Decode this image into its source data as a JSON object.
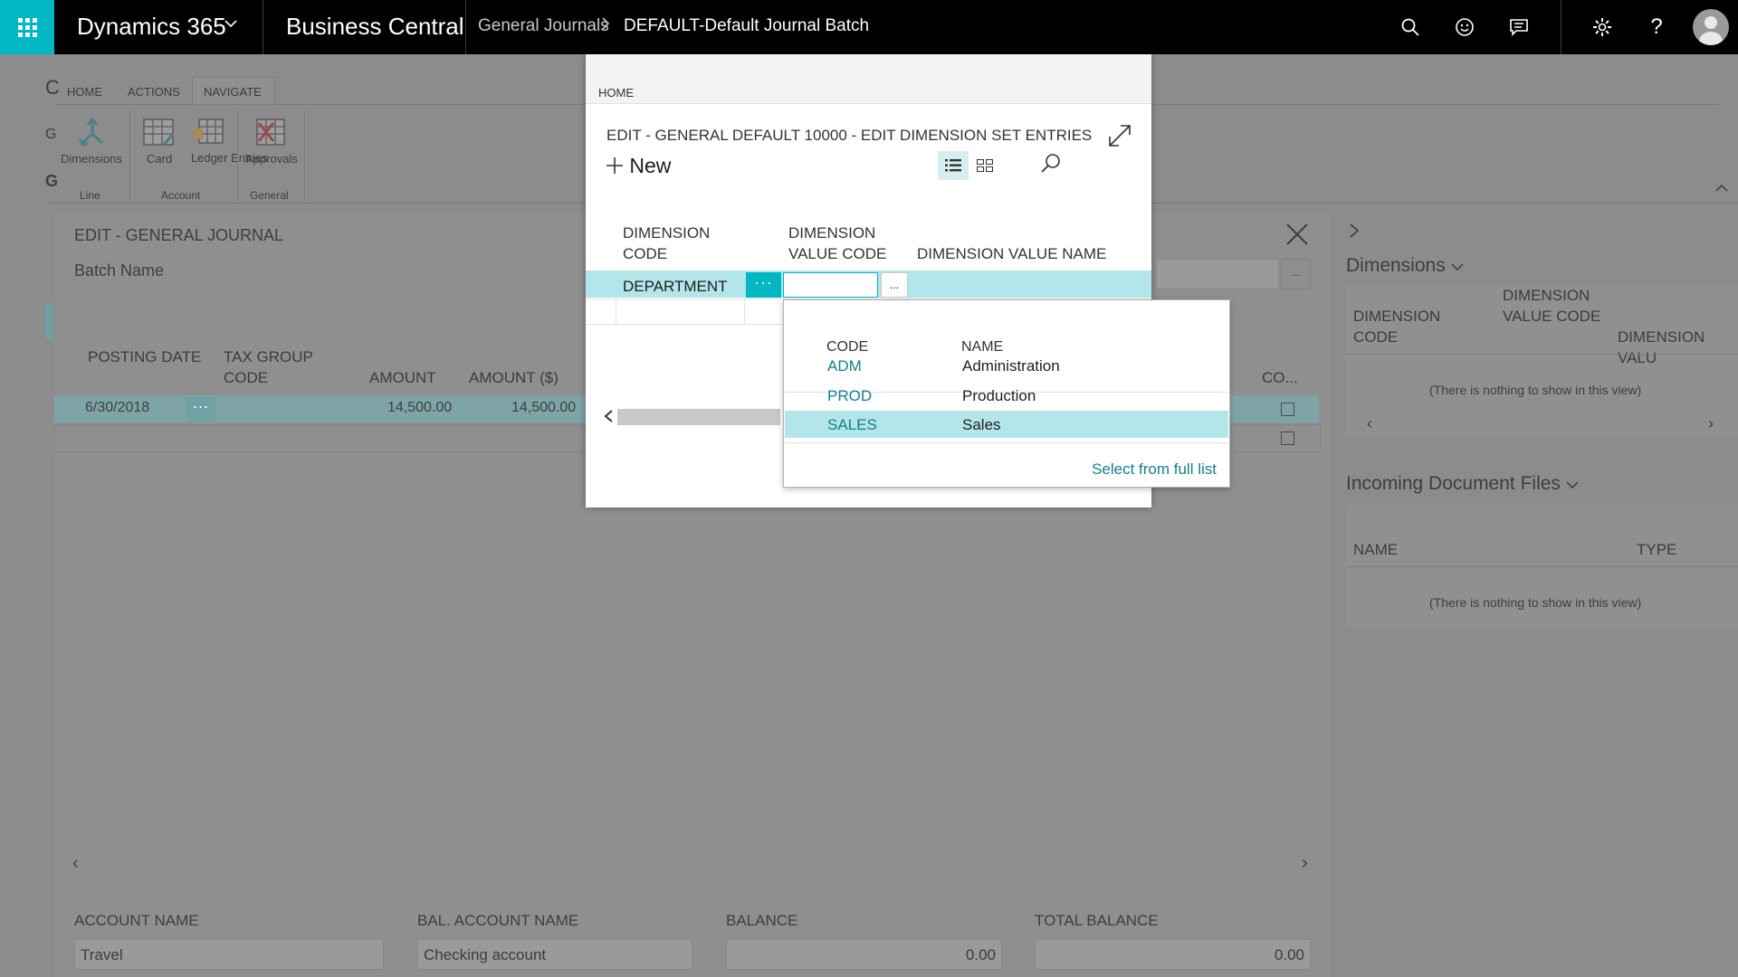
{
  "topbar": {
    "app_name": "Dynamics 365",
    "product": "Business Central",
    "breadcrumb_parent": "General Journals",
    "breadcrumb_current": "DEFAULT-Default Journal Batch",
    "icons": [
      "search-icon",
      "smiley-icon",
      "chat-icon",
      "gear-icon",
      "help-icon",
      "avatar"
    ]
  },
  "ribbon": {
    "tabs": [
      "HOME",
      "ACTIONS",
      "NAVIGATE"
    ],
    "active_tab": "NAVIGATE",
    "buttons": {
      "dimensions": "Dimensions",
      "card": "Card",
      "ledger_entries": "Ledger Entries",
      "approvals": "Approvals"
    },
    "groups": {
      "line": "Line",
      "account": "Account",
      "general": "General"
    }
  },
  "journal": {
    "title": "EDIT - GENERAL JOURNAL",
    "batch_label": "Batch Name",
    "columns": {
      "posting_date": "POSTING DATE",
      "tax_group_code": "TAX GROUP CODE",
      "amount": "AMOUNT",
      "amount_usd": "AMOUNT ($)",
      "co": "CO..."
    },
    "row": {
      "posting_date": "6/30/2018",
      "amount": "14,500.00",
      "amount_usd": "14,500.00",
      "dots": "···"
    },
    "footer": {
      "account_name_label": "ACCOUNT NAME",
      "account_name": "Travel",
      "bal_account_name_label": "BAL. ACCOUNT NAME",
      "bal_account_name": "Checking account",
      "balance_label": "BALANCE",
      "balance": "0.00",
      "total_balance_label": "TOTAL BALANCE",
      "total_balance": "0.00"
    }
  },
  "factbox": {
    "dimensions_title": "Dimensions",
    "dim_cols": {
      "code": "DIMENSION CODE",
      "value_code": "DIMENSION VALUE CODE",
      "value_name": "DIMENSION VALU"
    },
    "empty_text": "(There is nothing to show in this view)",
    "incoming_title": "Incoming Document Files",
    "incoming_cols": {
      "name": "NAME",
      "type": "TYPE"
    },
    "incoming_empty": "(There is nothing to show in this view)"
  },
  "modal": {
    "tab": "HOME",
    "title": "EDIT - GENERAL DEFAULT 10000 - EDIT DIMENSION SET ENTRIES",
    "new_label": "New",
    "columns": {
      "dimension_code": "DIMENSION CODE",
      "dimension_value_code": "DIMENSION VALUE CODE",
      "dimension_value_name": "DIMENSION VALUE NAME"
    },
    "row": {
      "dimension_code": "DEPARTMENT",
      "dots": "···",
      "lookup": "..."
    }
  },
  "dropdown": {
    "headers": {
      "code": "CODE",
      "name": "NAME"
    },
    "items": [
      {
        "code": "ADM",
        "name": "Administration"
      },
      {
        "code": "PROD",
        "name": "Production"
      },
      {
        "code": "SALES",
        "name": "Sales"
      }
    ],
    "selected_index": 2,
    "select_full_list": "Select from full list"
  },
  "colors": {
    "accent": "#00b7c3",
    "selected_row": "#b3e6ea",
    "link": "#137f8c"
  }
}
